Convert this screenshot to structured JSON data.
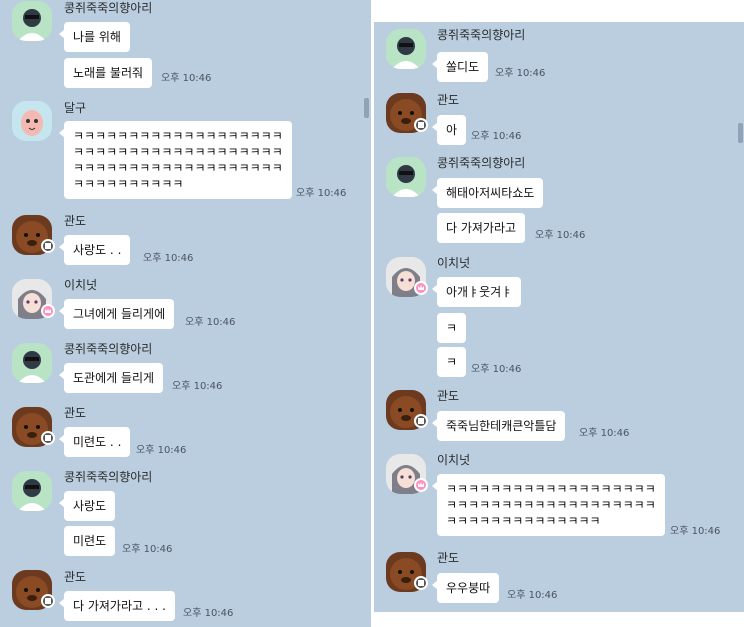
{
  "colors": {
    "chat_background": "#bacee0",
    "bubble": "#ffffff",
    "avatar_green": "#b9e3c5",
    "avatar_teal": "#c5e6ef",
    "avatar_gray": "#e8e8e8"
  },
  "left_panel": {
    "messages": [
      {
        "sender": "콩쥐죽죽의향아리",
        "avatar": "green-character-avatar",
        "bubbles": [
          "나를 위해",
          "노래를 불러줘"
        ],
        "time": "오후 10:46"
      },
      {
        "sender": "달구",
        "avatar": "peach-character-avatar",
        "bubbles": [
          "ㅋㅋㅋㅋㅋㅋㅋㅋㅋㅋㅋㅋㅋㅋㅋㅋㅋㅋㅋ\nㅋㅋㅋㅋㅋㅋㅋㅋㅋㅋㅋㅋㅋㅋㅋㅋㅋㅋㅋ\nㅋㅋㅋㅋㅋㅋㅋㅋㅋㅋㅋㅋㅋㅋㅋㅋㅋㅋㅋ\nㅋㅋㅋㅋㅋㅋㅋㅋㅋㅋ"
        ],
        "time": "오후 10:46"
      },
      {
        "sender": "관도",
        "avatar": "brown-bear-avatar",
        "bubbles": [
          "사랑도 . ."
        ],
        "time": "오후 10:46"
      },
      {
        "sender": "이치넛",
        "avatar": "anime-character-avatar",
        "bubbles": [
          "그녀에게 들리게에"
        ],
        "time": "오후 10:46"
      },
      {
        "sender": "콩쥐죽죽의향아리",
        "avatar": "green-character-avatar",
        "bubbles": [
          "도관에게 들리게"
        ],
        "time": "오후 10:46"
      },
      {
        "sender": "관도",
        "avatar": "brown-bear-avatar",
        "bubbles": [
          "미련도 . ."
        ],
        "time": "오후 10:46"
      },
      {
        "sender": "콩쥐죽죽의향아리",
        "avatar": "green-character-avatar",
        "bubbles": [
          "사랑도",
          "미련도"
        ],
        "time": "오후 10:46"
      },
      {
        "sender": "관도",
        "avatar": "brown-bear-avatar",
        "bubbles": [
          "다 가져가라고 . . ."
        ],
        "time": "오후 10:46"
      }
    ]
  },
  "right_panel": {
    "messages": [
      {
        "sender": "콩쥐죽죽의향아리",
        "avatar": "green-character-avatar",
        "bubbles": [
          "쏠디도"
        ],
        "time": "오후 10:46"
      },
      {
        "sender": "관도",
        "avatar": "brown-bear-avatar",
        "bubbles": [
          "아"
        ],
        "time": "오후 10:46"
      },
      {
        "sender": "콩쥐죽죽의향아리",
        "avatar": "green-character-avatar",
        "bubbles": [
          "해태아저씨타쇼도",
          "다 가져가라고"
        ],
        "time": "오후 10:46"
      },
      {
        "sender": "이치넛",
        "avatar": "anime-character-avatar",
        "bubbles": [
          "아개ㅑ웃겨ㅑ",
          "ㅋ",
          "ㅋ"
        ],
        "time": "오후 10:46"
      },
      {
        "sender": "관도",
        "avatar": "brown-bear-avatar",
        "bubbles": [
          "죽죽님한테캐큰악틀담"
        ],
        "time": "오후 10:46"
      },
      {
        "sender": "이치넛",
        "avatar": "anime-character-avatar",
        "bubbles": [
          "ㅋㅋㅋㅋㅋㅋㅋㅋㅋㅋㅋㅋㅋㅋㅋㅋㅋㅋㅋ\nㅋㅋㅋㅋㅋㅋㅋㅋㅋㅋㅋㅋㅋㅋㅋㅋㅋㅋㅋ\nㅋㅋㅋㅋㅋㅋㅋㅋㅋㅋㅋㅋㅋㅋ"
        ],
        "time": "오후 10:46"
      },
      {
        "sender": "관도",
        "avatar": "brown-bear-avatar",
        "bubbles": [
          "우우붕따"
        ],
        "time": "오후 10:46"
      }
    ]
  }
}
